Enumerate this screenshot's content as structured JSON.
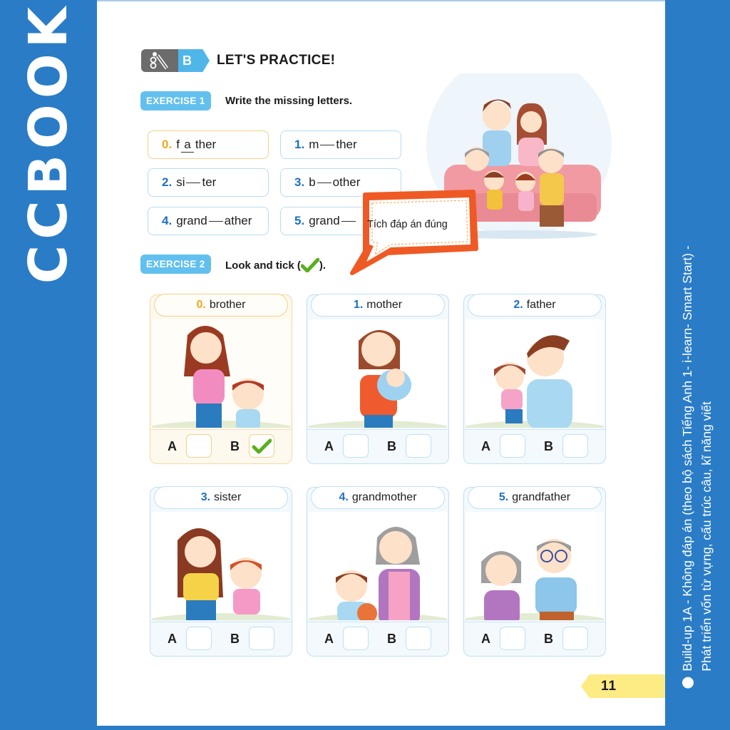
{
  "brand": {
    "logo_text": "CCBOOK"
  },
  "side_caption": {
    "line1": "Build-up 1A - Không đáp án (theo bộ sách Tiếng Anh 1- i-learn- Smart Start) -",
    "line2": "Phát triển vốn từ vựng, cấu trúc câu, kĩ năng viết"
  },
  "section": {
    "badge": "B",
    "title": "LET'S PRACTICE!",
    "icon": "pencil-icon"
  },
  "exercise1": {
    "tag": "EXERCISE 1",
    "instruction": "Write the missing letters.",
    "items": [
      {
        "num": "0.",
        "pre": "f",
        "answer": "a",
        "post": "ther",
        "example": true
      },
      {
        "num": "1.",
        "pre": "m",
        "answer": "",
        "post": "ther"
      },
      {
        "num": "2.",
        "pre": "si",
        "answer": "",
        "post": "ter"
      },
      {
        "num": "3.",
        "pre": "b",
        "answer": "",
        "post": "other"
      },
      {
        "num": "4.",
        "pre": "grand",
        "answer": "",
        "post": "ather"
      },
      {
        "num": "5.",
        "pre": "grand",
        "answer": "",
        "post": ""
      }
    ]
  },
  "bubble": {
    "text": "Tích đáp án đúng"
  },
  "exercise2": {
    "tag": "EXERCISE 2",
    "instruction": "Look and tick (",
    "instruction_end": ").",
    "tick_icon": "checkmark-icon",
    "cards": [
      {
        "num": "0.",
        "word": "brother",
        "option_a": "A",
        "option_b": "B",
        "checked": "B",
        "example": true
      },
      {
        "num": "1.",
        "word": "mother",
        "option_a": "A",
        "option_b": "B",
        "checked": ""
      },
      {
        "num": "2.",
        "word": "father",
        "option_a": "A",
        "option_b": "B",
        "checked": ""
      },
      {
        "num": "3.",
        "word": "sister",
        "option_a": "A",
        "option_b": "B",
        "checked": ""
      },
      {
        "num": "4.",
        "word": "grandmother",
        "option_a": "A",
        "option_b": "B",
        "checked": ""
      },
      {
        "num": "5.",
        "word": "grandfather",
        "option_a": "A",
        "option_b": "B",
        "checked": ""
      }
    ]
  },
  "page_number": "11",
  "colors": {
    "brand_blue": "#2a7cc7",
    "exercise_tag": "#62c0ef",
    "number_blue": "#1d6fbd",
    "example_orange": "#f0a820",
    "bubble_orange": "#ef5a24",
    "page_tab": "#fdeb84",
    "tick_green": "#5aae1e"
  }
}
